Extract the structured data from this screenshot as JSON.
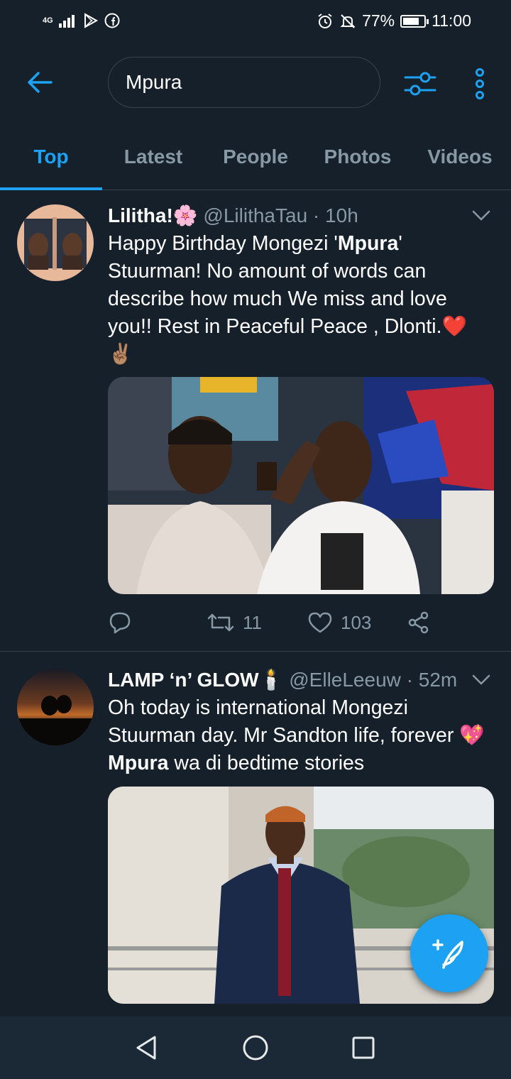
{
  "status_bar": {
    "network": "4G",
    "battery_percent": "77%",
    "battery_level": 0.77,
    "time": "11:00",
    "icons": [
      "signal-icon",
      "play-store-icon",
      "facebook-icon",
      "alarm-icon",
      "mute-icon",
      "battery-icon"
    ]
  },
  "search": {
    "query": "Mpura",
    "icons": [
      "back-arrow-icon",
      "filter-sliders-icon",
      "more-vertical-icon"
    ]
  },
  "tabs": [
    {
      "label": "Top",
      "active": true
    },
    {
      "label": "Latest",
      "active": false
    },
    {
      "label": "People",
      "active": false
    },
    {
      "label": "Photos",
      "active": false
    },
    {
      "label": "Videos",
      "active": false
    }
  ],
  "tweets": [
    {
      "display_name": "Lilitha!",
      "name_emoji": "🌸",
      "handle": "@LilithaTau",
      "time": "10h",
      "text_before": "Happy Birthday Mongezi '",
      "text_highlight": "Mpura",
      "text_after": "' Stuurman! No amount of words can describe how much We miss and love you!! Rest in Peaceful Peace , Dlonti.",
      "text_emoji": "❤️",
      "text_emoji2": "✌🏽",
      "retweets": "11",
      "likes": "103"
    },
    {
      "display_name": "LAMP ‘n’ GLOW",
      "name_emoji": "🕯️",
      "handle": "@ElleLeeuw",
      "time": "52m",
      "text_before": "Oh today is international Mongezi Stuurman day. Mr Sandton life, forever ",
      "text_emoji": "💖",
      "text_highlight": "Mpura",
      "text_after": " wa di bedtime stories"
    }
  ],
  "colors": {
    "background": "#15202b",
    "accent": "#1da1f2",
    "secondary_text": "#8899a6",
    "border": "#38444d",
    "heart_emoji": "#e0245e"
  }
}
